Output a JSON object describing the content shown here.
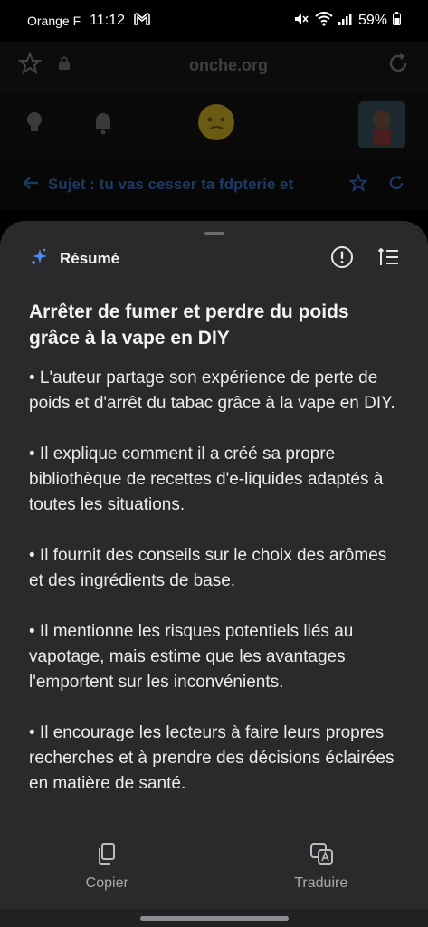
{
  "status_bar": {
    "carrier": "Orange F",
    "time": "11:12",
    "battery": "59%",
    "icons": [
      "gmail-icon",
      "mute-icon",
      "wifi-icon",
      "signal-icon",
      "battery-icon"
    ]
  },
  "browser": {
    "url": "onche.org",
    "topic_title": "Sujet : tu vas cesser ta fdpterie et"
  },
  "sheet": {
    "title": "Résumé",
    "heading": "Arrêter de fumer et perdre du poids grâce à la vape en DIY",
    "bullets": [
      "• L'auteur partage son expérience de perte de poids et d'arrêt du tabac grâce à la vape en DIY.",
      "• Il explique comment il a créé sa propre bibliothèque de recettes d'e-liquides adaptés à toutes les situations.",
      "• Il fournit des conseils sur le choix des arômes et des ingrédients de base.",
      "• Il mentionne les risques potentiels liés au vapotage, mais estime que les avantages l'emportent sur les inconvénients.",
      "• Il encourage les lecteurs à faire leurs propres recherches et à prendre des décisions éclairées en matière de santé."
    ],
    "footer": {
      "copy_label": "Copier",
      "translate_label": "Traduire"
    }
  },
  "colors": {
    "sheet_bg": "#2a2a2c",
    "sparkle_blue": "#4a8cf7",
    "accent_dim": "#1c3a66"
  }
}
